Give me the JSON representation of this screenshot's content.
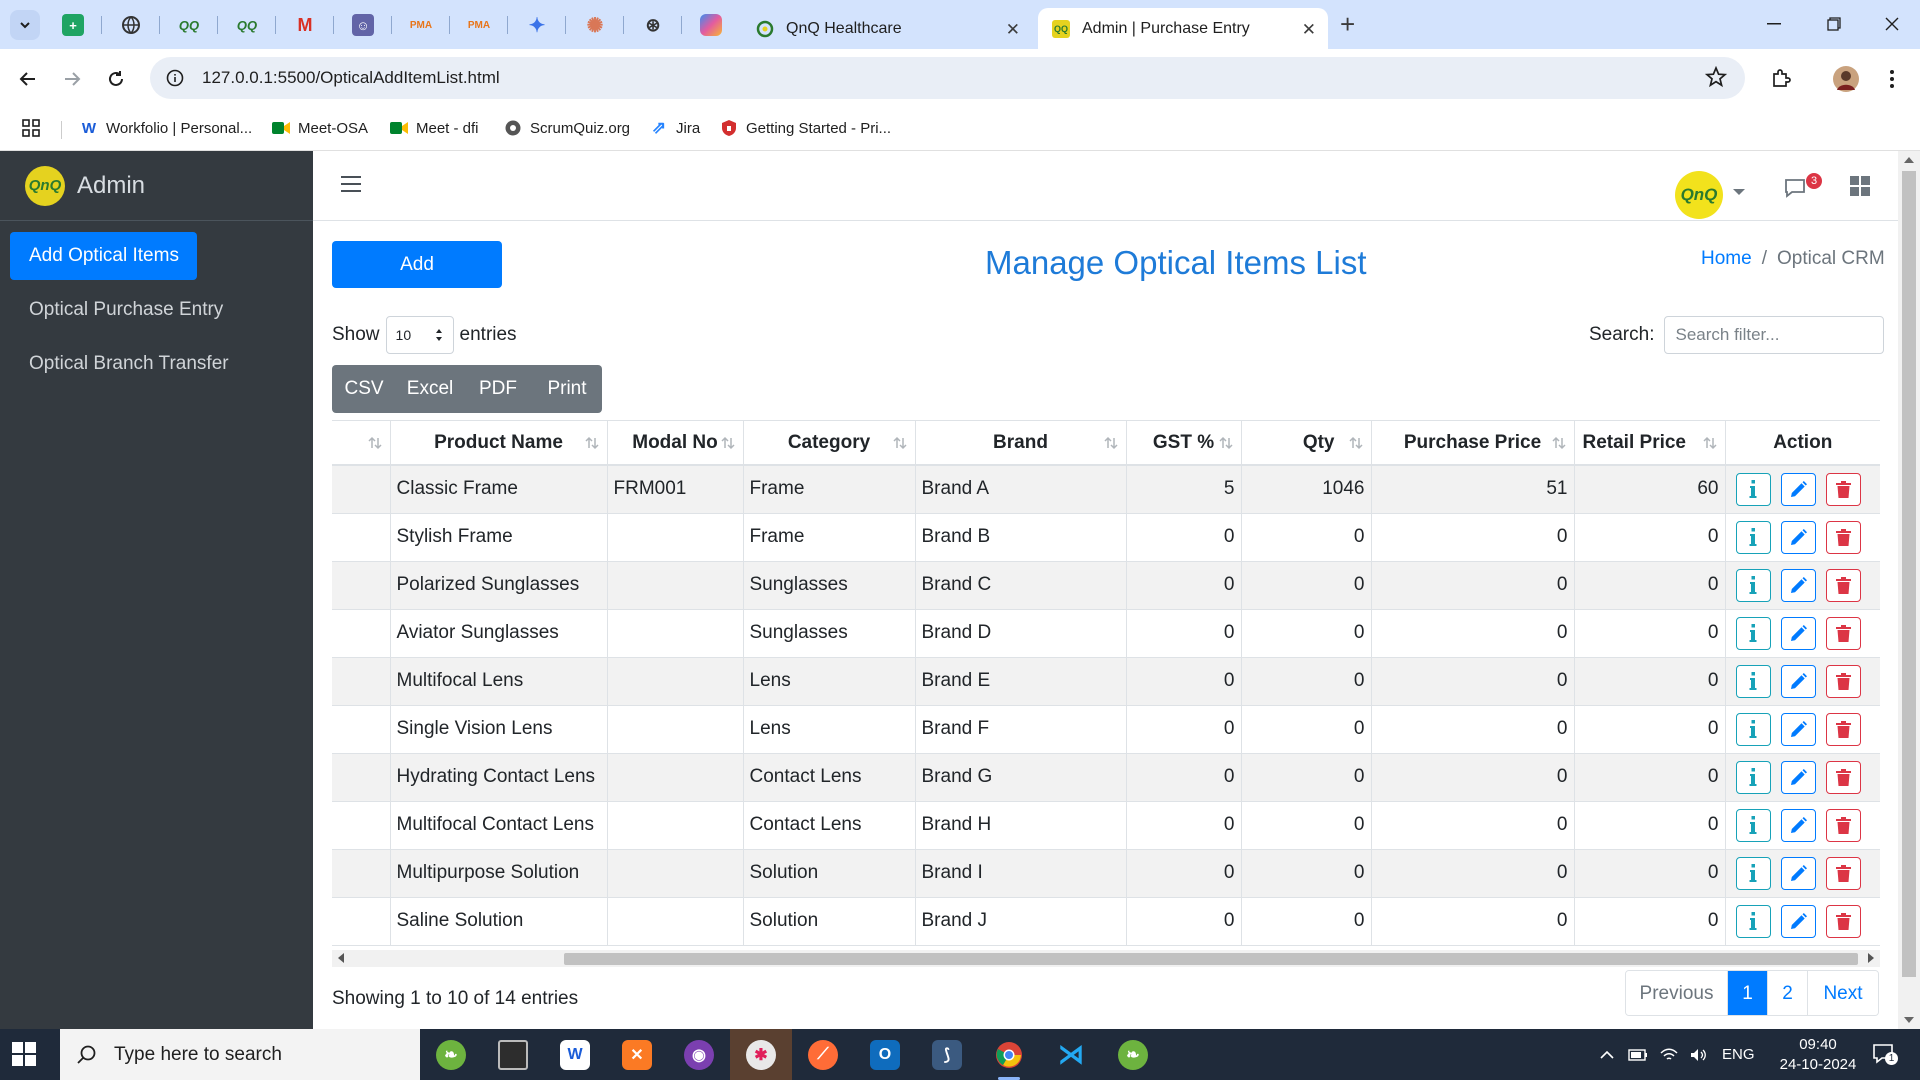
{
  "browser": {
    "tabs": [
      {
        "title": "QnQ Healthcare",
        "active": false
      },
      {
        "title": "Admin | Purchase Entry",
        "active": true
      }
    ],
    "url": "127.0.0.1:5500/OpticalAddItemList.html",
    "bookmarks": [
      {
        "label": "Workfolio | Personal...",
        "icon": "workfolio-icon"
      },
      {
        "label": "Meet-OSA",
        "icon": "meet-icon"
      },
      {
        "label": "Meet - dfi",
        "icon": "meet-icon"
      },
      {
        "label": "ScrumQuiz.org",
        "icon": "scrumquiz-icon"
      },
      {
        "label": "Jira",
        "icon": "jira-icon"
      },
      {
        "label": "Getting Started - Pri...",
        "icon": "shield-icon"
      }
    ],
    "colors": {
      "tabbar": "#d3e3fd",
      "omnibox": "#e9eef6"
    }
  },
  "sidebar": {
    "brand": "Admin",
    "brand_logo": "QnQ",
    "items": [
      {
        "label": "Add Optical Items",
        "active": true
      },
      {
        "label": "Optical Purchase Entry",
        "active": false
      },
      {
        "label": "Optical Branch Transfer",
        "active": false
      }
    ]
  },
  "topnav": {
    "avatar_text": "QnQ",
    "message_count": "3"
  },
  "page": {
    "add_button": "Add",
    "title": "Manage Optical Items List",
    "breadcrumb": {
      "home": "Home",
      "separator": "/",
      "current": "Optical CRM"
    },
    "show_label": "Show",
    "entries_value": "10",
    "entries_label": "entries",
    "search_label": "Search:",
    "search_placeholder": "Search filter...",
    "export_buttons": [
      "CSV",
      "Excel",
      "PDF",
      "Print"
    ]
  },
  "table": {
    "columns": [
      "",
      "Product Name",
      "Modal No",
      "Category",
      "Brand",
      "GST %",
      "Qty",
      "Purchase Price",
      "Retail Price",
      "Action"
    ],
    "rows": [
      {
        "product": "Classic Frame",
        "modal": "FRM001",
        "category": "Frame",
        "brand": "Brand A",
        "gst": "5",
        "qty": "1046",
        "purchase": "51",
        "retail": "60"
      },
      {
        "product": "Stylish Frame",
        "modal": "",
        "category": "Frame",
        "brand": "Brand B",
        "gst": "0",
        "qty": "0",
        "purchase": "0",
        "retail": "0"
      },
      {
        "product": "Polarized Sunglasses",
        "modal": "",
        "category": "Sunglasses",
        "brand": "Brand C",
        "gst": "0",
        "qty": "0",
        "purchase": "0",
        "retail": "0"
      },
      {
        "product": "Aviator Sunglasses",
        "modal": "",
        "category": "Sunglasses",
        "brand": "Brand D",
        "gst": "0",
        "qty": "0",
        "purchase": "0",
        "retail": "0"
      },
      {
        "product": "Multifocal Lens",
        "modal": "",
        "category": "Lens",
        "brand": "Brand E",
        "gst": "0",
        "qty": "0",
        "purchase": "0",
        "retail": "0"
      },
      {
        "product": "Single Vision Lens",
        "modal": "",
        "category": "Lens",
        "brand": "Brand F",
        "gst": "0",
        "qty": "0",
        "purchase": "0",
        "retail": "0"
      },
      {
        "product": "Hydrating Contact Lens",
        "modal": "",
        "category": "Contact Lens",
        "brand": "Brand G",
        "gst": "0",
        "qty": "0",
        "purchase": "0",
        "retail": "0"
      },
      {
        "product": "Multifocal Contact Lens",
        "modal": "",
        "category": "Contact Lens",
        "brand": "Brand H",
        "gst": "0",
        "qty": "0",
        "purchase": "0",
        "retail": "0"
      },
      {
        "product": "Multipurpose Solution",
        "modal": "",
        "category": "Solution",
        "brand": "Brand I",
        "gst": "0",
        "qty": "0",
        "purchase": "0",
        "retail": "0"
      },
      {
        "product": "Saline Solution",
        "modal": "",
        "category": "Solution",
        "brand": "Brand J",
        "gst": "0",
        "qty": "0",
        "purchase": "0",
        "retail": "0"
      }
    ],
    "action_icons": [
      "info-icon",
      "pencil-icon",
      "trash-icon"
    ]
  },
  "footer": {
    "info": "Showing 1 to 10 of 14 entries",
    "pagination": [
      "Previous",
      "1",
      "2",
      "Next"
    ],
    "current_page": "1"
  },
  "taskbar": {
    "search_placeholder": "Type here to search",
    "language": "ENG",
    "time": "09:40",
    "date": "24-10-2024",
    "notification_count": "1"
  },
  "theme": {
    "primary": "#007bff",
    "sidebar_bg": "#343a40",
    "danger": "#dc3545",
    "info": "#17a2b8",
    "title_color": "#1e7bd8"
  }
}
